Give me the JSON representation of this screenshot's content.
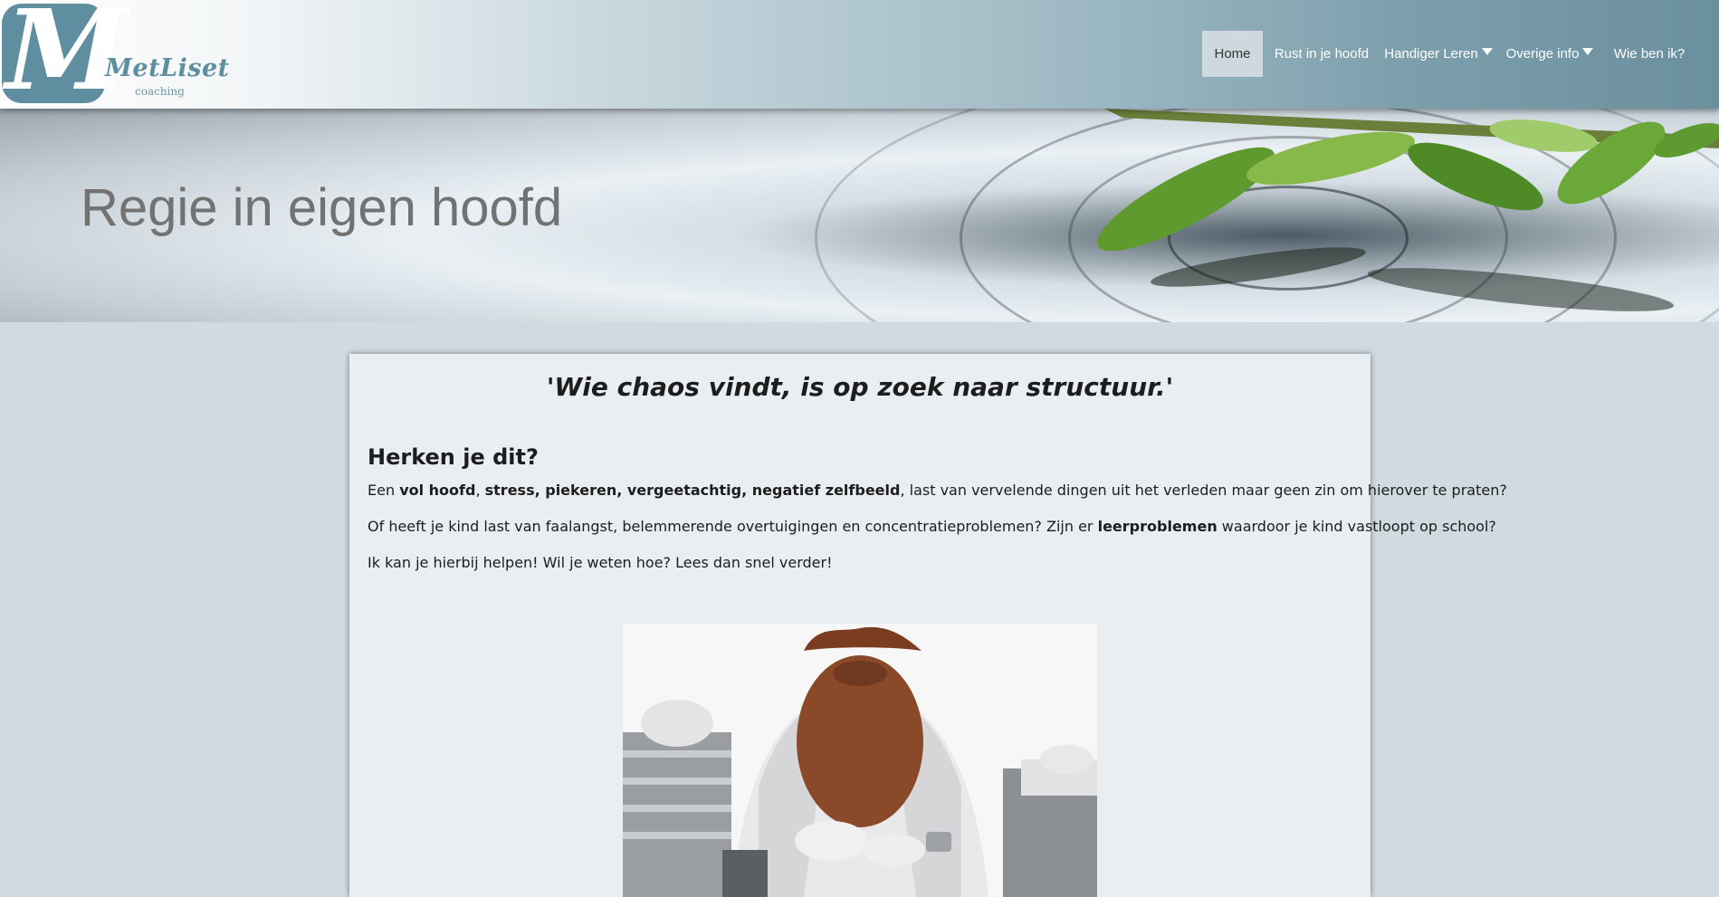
{
  "logo": {
    "name": "MetLiset",
    "subtitle": "coaching",
    "letter": "M"
  },
  "nav": {
    "items": [
      {
        "label": "Home"
      },
      {
        "label": "Rust in je hoofd"
      },
      {
        "label": "Handiger Leren"
      },
      {
        "label": "Overige info"
      },
      {
        "label": "Wie ben ik?"
      }
    ]
  },
  "hero": {
    "title": "Regie in eigen hoofd"
  },
  "content": {
    "quote": "'Wie chaos vindt, is op zoek naar structuur.'",
    "heading": "Herken je dit?",
    "p1": {
      "t1": "Een ",
      "b1": "vol hoofd",
      "t2": ", ",
      "b2": "stress, piekeren, vergeetachtig, negatief zelfbeeld",
      "t3": ", last van vervelende dingen uit het verleden maar geen zin om hierover te praten?"
    },
    "p2": {
      "t1": "Of heeft je kind last van faalangst, belemmerende overtuigingen en concentratieproblemen? Zijn er ",
      "b1": "leerproblemen",
      "t2": " waardoor je kind vastloopt op school?"
    },
    "p3": "Ik kan je hierbij helpen! Wil je weten hoe? Lees dan snel verder!"
  },
  "colors": {
    "header_end": "#6a8f9d",
    "logo": "#5f8ea1",
    "page_bg": "#cfdbe0",
    "card_bg": "#e8eef1"
  },
  "icons": {
    "dropdown": "caret-down-icon"
  }
}
